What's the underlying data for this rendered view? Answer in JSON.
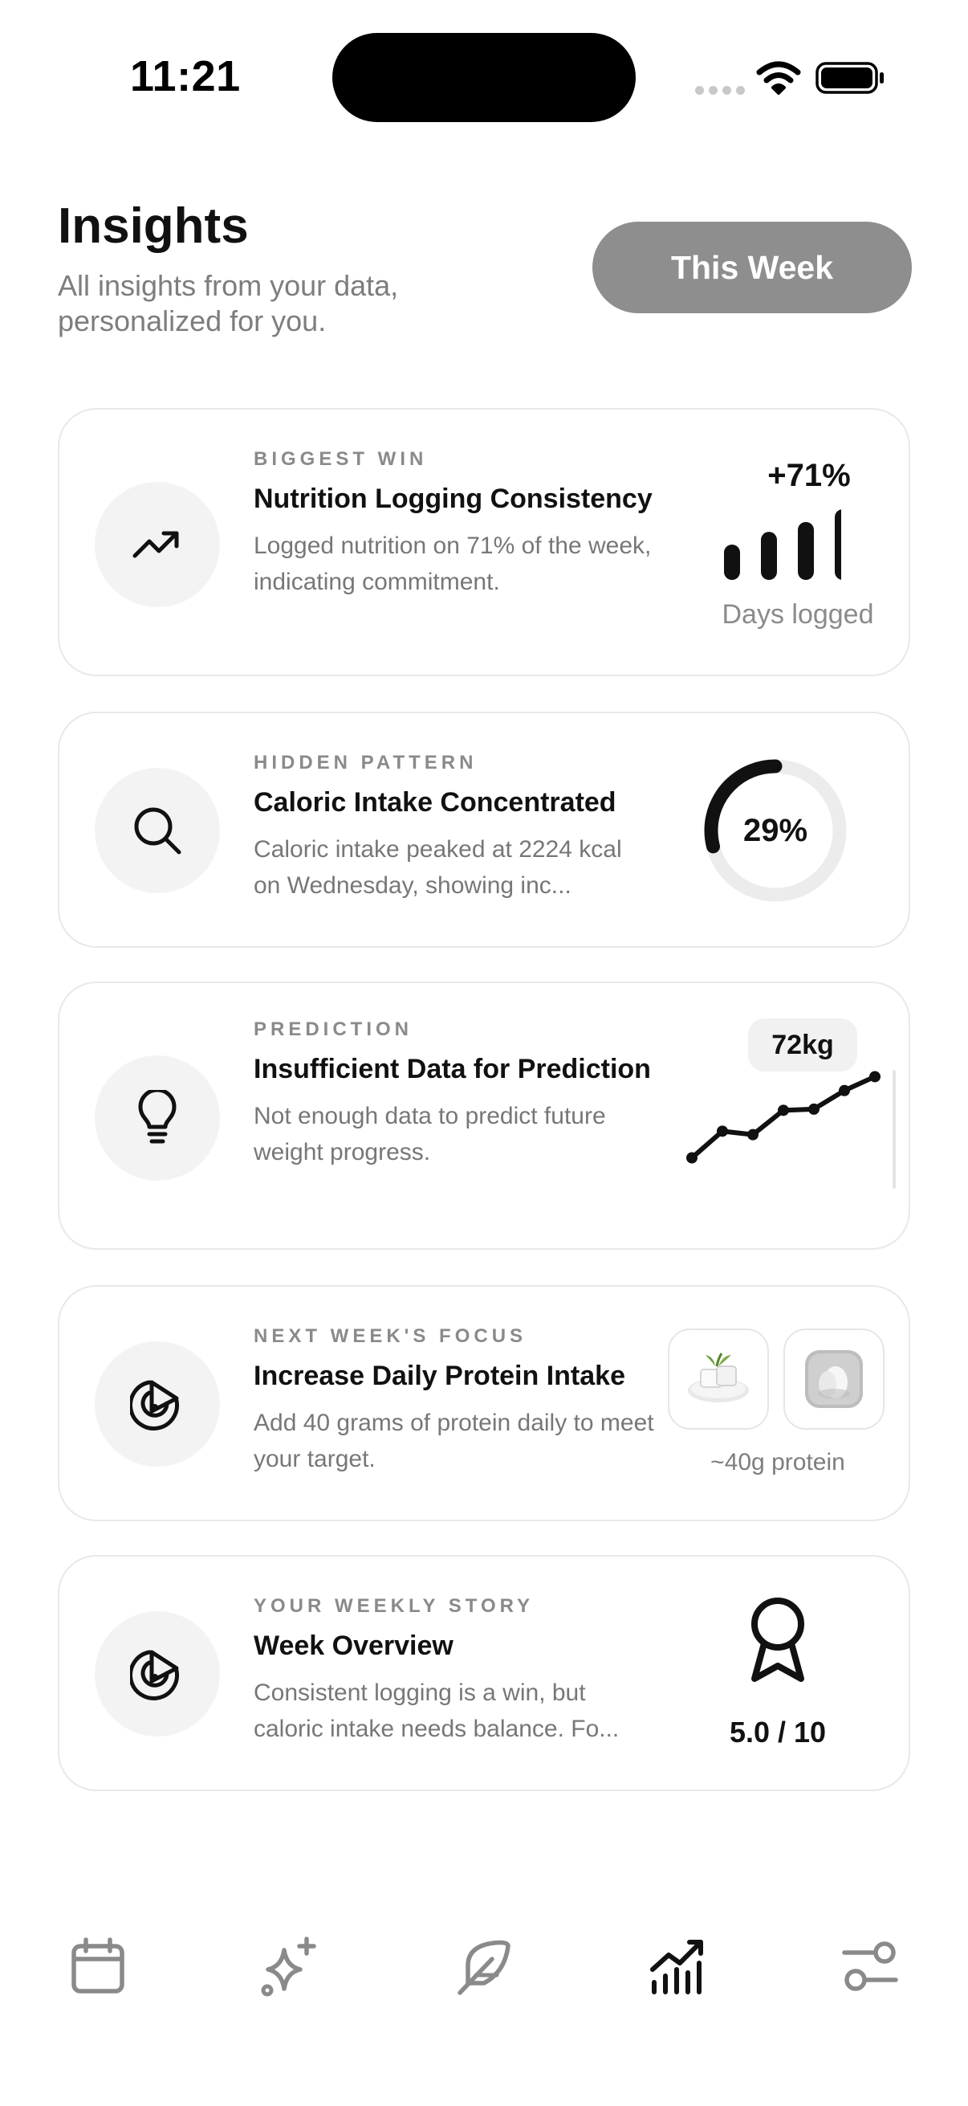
{
  "status_bar": {
    "time": "11:21"
  },
  "header": {
    "title": "Insights",
    "subtitle": "All insights from your data, personalized for you.",
    "range_button": "This Week"
  },
  "cards": [
    {
      "eyebrow": "BIGGEST WIN",
      "title": "Nutrition Logging Consistency",
      "description": "Logged nutrition on 71% of the week, indicating commitment.",
      "icon": "trending-up-icon",
      "metric": "+71%",
      "bar_levels": [
        0.5,
        0.68,
        0.82,
        1.0
      ],
      "caption": "Days logged"
    },
    {
      "eyebrow": "HIDDEN PATTERN",
      "title": "Caloric Intake Concentrated",
      "description": "Caloric intake peaked at 2224 kcal on Wednesday, showing inc...",
      "icon": "search-icon",
      "metric": "29%",
      "ring_fraction": 0.29
    },
    {
      "eyebrow": "PREDICTION",
      "title": "Insufficient Data for Prediction",
      "description": "Not enough data to predict future weight progress.",
      "icon": "lightbulb-icon",
      "metric": "72kg",
      "trend_values": [
        1,
        3.3,
        3.0,
        5.1,
        5.2,
        6.8,
        8.0
      ]
    },
    {
      "eyebrow": "NEXT WEEK'S FOCUS",
      "title": "Increase Daily Protein Intake",
      "description": "Add 40 grams of protein daily to meet your target.",
      "icon": "target-icon",
      "caption": "~40g protein"
    },
    {
      "eyebrow": "YOUR WEEKLY STORY",
      "title": "Week Overview",
      "description": "Consistent logging is a win, but caloric intake needs balance. Fo...",
      "icon": "target-icon",
      "score": "5.0 / 10"
    }
  ],
  "tab_bar": {
    "items": [
      "calendar-icon",
      "sparkles-icon",
      "feather-icon",
      "chart-icon",
      "sliders-icon"
    ],
    "active": "chart-icon"
  },
  "colors": {
    "accent": "#111111",
    "muted": "#8a8a8a",
    "card_border": "#e8e8e8",
    "icon_bg": "#f3f3f3",
    "button": "#8e8e8e"
  }
}
